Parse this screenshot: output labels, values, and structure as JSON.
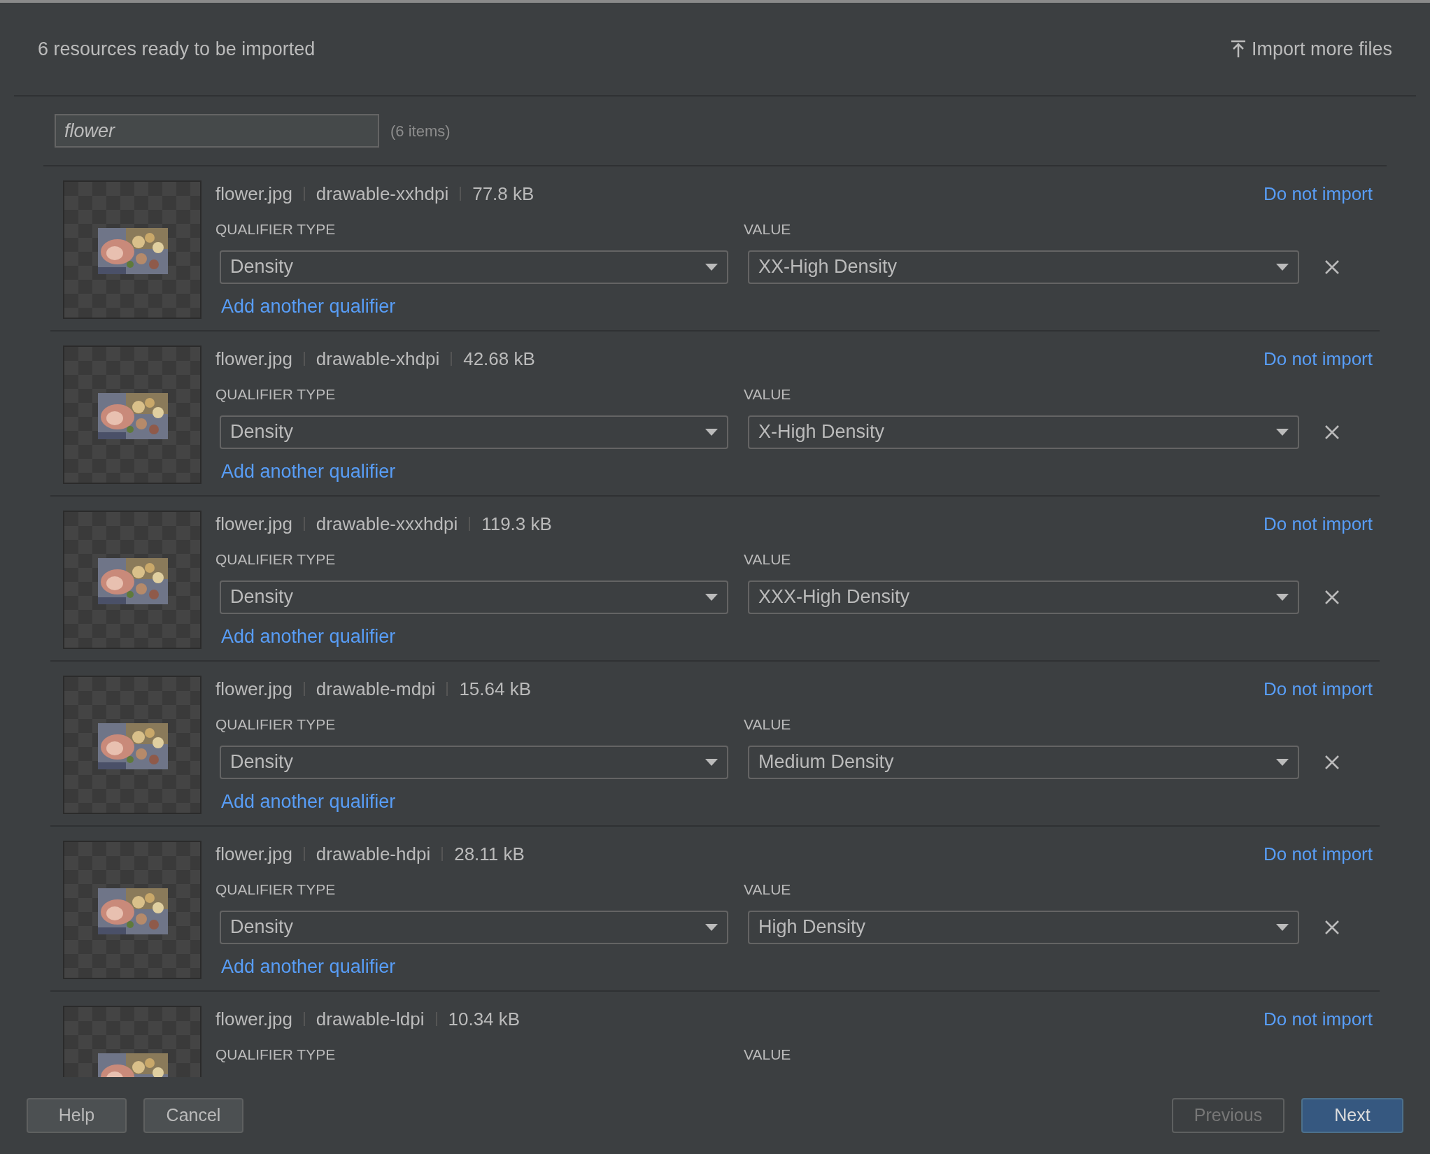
{
  "header": {
    "title": "6 resources ready to be imported",
    "import_more": "Import more files"
  },
  "search": {
    "value": "flower",
    "count": "(6 items)"
  },
  "resources": [
    {
      "file": "flower.jpg",
      "folder": "drawable-xxhdpi",
      "size": "77.8 kB",
      "remove": "Do not import",
      "type_label": "QUALIFIER TYPE",
      "value_label": "VALUE",
      "qualifier_type": "Density",
      "value": "XX-High Density",
      "add": "Add another qualifier"
    },
    {
      "file": "flower.jpg",
      "folder": "drawable-xhdpi",
      "size": "42.68 kB",
      "remove": "Do not import",
      "type_label": "QUALIFIER TYPE",
      "value_label": "VALUE",
      "qualifier_type": "Density",
      "value": "X-High Density",
      "add": "Add another qualifier"
    },
    {
      "file": "flower.jpg",
      "folder": "drawable-xxxhdpi",
      "size": "119.3 kB",
      "remove": "Do not import",
      "type_label": "QUALIFIER TYPE",
      "value_label": "VALUE",
      "qualifier_type": "Density",
      "value": "XXX-High Density",
      "add": "Add another qualifier"
    },
    {
      "file": "flower.jpg",
      "folder": "drawable-mdpi",
      "size": "15.64 kB",
      "remove": "Do not import",
      "type_label": "QUALIFIER TYPE",
      "value_label": "VALUE",
      "qualifier_type": "Density",
      "value": "Medium Density",
      "add": "Add another qualifier"
    },
    {
      "file": "flower.jpg",
      "folder": "drawable-hdpi",
      "size": "28.11 kB",
      "remove": "Do not import",
      "type_label": "QUALIFIER TYPE",
      "value_label": "VALUE",
      "qualifier_type": "Density",
      "value": "High Density",
      "add": "Add another qualifier"
    },
    {
      "file": "flower.jpg",
      "folder": "drawable-ldpi",
      "size": "10.34 kB",
      "remove": "Do not import",
      "type_label": "QUALIFIER TYPE",
      "value_label": "VALUE"
    }
  ],
  "buttons": [
    {
      "label": "Help",
      "kind": "normal",
      "disabled": false
    },
    {
      "label": "Cancel",
      "kind": "normal",
      "disabled": false
    },
    {
      "label": "Previous",
      "kind": "normal",
      "disabled": true
    },
    {
      "label": "Next",
      "kind": "default",
      "disabled": false
    }
  ]
}
